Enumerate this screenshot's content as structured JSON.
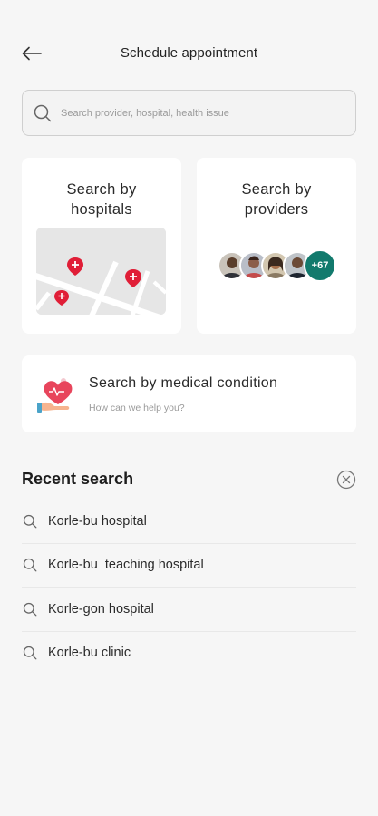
{
  "header": {
    "title": "Schedule appointment",
    "back_icon": "arrow-left-icon"
  },
  "search": {
    "placeholder": "Search provider, hospital, health issue",
    "value": "",
    "icon": "search-icon"
  },
  "cards": {
    "hospitals": {
      "title": "Search by\nhospitals",
      "image": "map-with-pins"
    },
    "providers": {
      "title": "Search by\nproviders",
      "more_count": "+67"
    },
    "condition": {
      "title": "Search by medical condition",
      "subtitle": "How can we help you?",
      "icon": "heart-in-hand-icon"
    }
  },
  "recent": {
    "title": "Recent search",
    "clear_icon": "close-circle-icon",
    "items": [
      {
        "label": "Korle-bu hospital"
      },
      {
        "label": "Korle-bu  teaching hospital"
      },
      {
        "label": "Korle-gon hospital"
      },
      {
        "label": "Korle-bu clinic"
      }
    ]
  },
  "colors": {
    "background": "#f6f6f6",
    "card": "#ffffff",
    "accent_teal": "#127a6d",
    "pin_red": "#e01e37"
  }
}
